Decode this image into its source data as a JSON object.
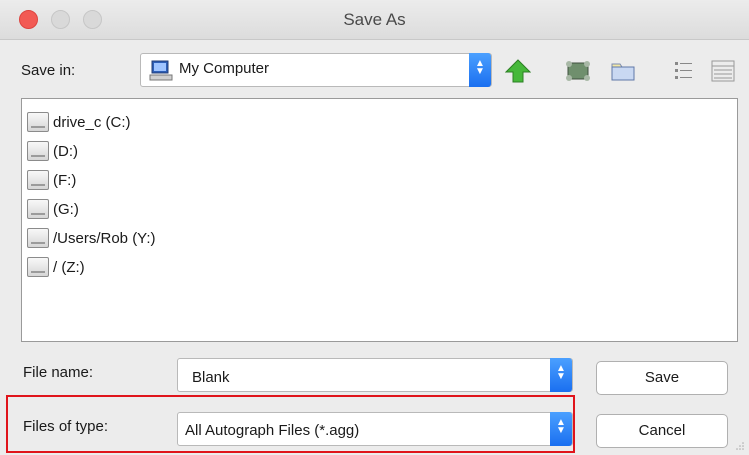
{
  "window": {
    "title": "Save As"
  },
  "save_in": {
    "label": "Save in:",
    "value": "My Computer"
  },
  "files": [
    {
      "name": "drive_c (C:)"
    },
    {
      "name": "(D:)"
    },
    {
      "name": "(F:)"
    },
    {
      "name": "(G:)"
    },
    {
      "name": "/Users/Rob (Y:)"
    },
    {
      "name": "/ (Z:)"
    }
  ],
  "file_name": {
    "label": "File name:",
    "value": "Blank"
  },
  "file_type": {
    "label": "Files of type:",
    "value": "All Autograph Files (*.agg)"
  },
  "buttons": {
    "save": "Save",
    "cancel": "Cancel"
  },
  "colors": {
    "accent": "#1a6ff0",
    "highlight": "#e0141b",
    "close": "#f25a54"
  }
}
